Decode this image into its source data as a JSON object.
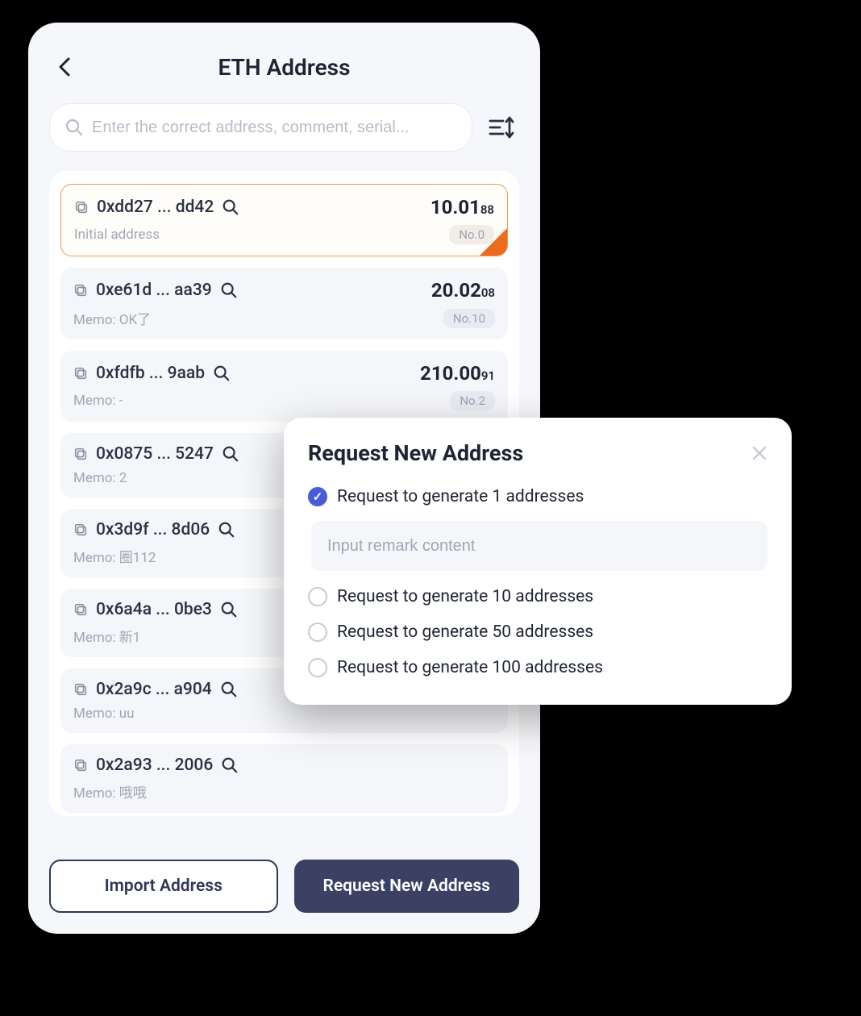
{
  "header": {
    "title": "ETH Address"
  },
  "search": {
    "placeholder": "Enter the correct address, comment, serial..."
  },
  "addresses": [
    {
      "short": "0xdd27 ... dd42",
      "balance_int": "10.01",
      "balance_dec": "88",
      "memo": "Initial address",
      "no": "No.0",
      "selected": true
    },
    {
      "short": "0xe61d ... aa39",
      "balance_int": "20.02",
      "balance_dec": "08",
      "memo": "Memo: OK了",
      "no": "No.10",
      "selected": false
    },
    {
      "short": "0xfdfb ... 9aab",
      "balance_int": "210.00",
      "balance_dec": "91",
      "memo": "Memo: -",
      "no": "No.2",
      "selected": false
    },
    {
      "short": "0x0875 ... 5247",
      "balance_int": "",
      "balance_dec": "",
      "memo": "Memo: 2",
      "no": "",
      "selected": false
    },
    {
      "short": "0x3d9f ... 8d06",
      "balance_int": "",
      "balance_dec": "",
      "memo": "Memo: 圈112",
      "no": "",
      "selected": false
    },
    {
      "short": "0x6a4a ... 0be3",
      "balance_int": "",
      "balance_dec": "",
      "memo": "Memo: 新1",
      "no": "",
      "selected": false
    },
    {
      "short": "0x2a9c ... a904",
      "balance_int": "",
      "balance_dec": "",
      "memo": "Memo: uu",
      "no": "",
      "selected": false
    },
    {
      "short": "0x2a93 ... 2006",
      "balance_int": "",
      "balance_dec": "",
      "memo": "Memo: 哦哦",
      "no": "",
      "selected": false
    }
  ],
  "buttons": {
    "import": "Import Address",
    "request": "Request New Address"
  },
  "modal": {
    "title": "Request New Address",
    "remark_placeholder": "Input remark content",
    "options": [
      {
        "label": "Request to generate 1 addresses",
        "checked": true
      },
      {
        "label": "Request to generate 10 addresses",
        "checked": false
      },
      {
        "label": "Request to generate 50 addresses",
        "checked": false
      },
      {
        "label": "Request to generate 100 addresses",
        "checked": false
      }
    ]
  }
}
